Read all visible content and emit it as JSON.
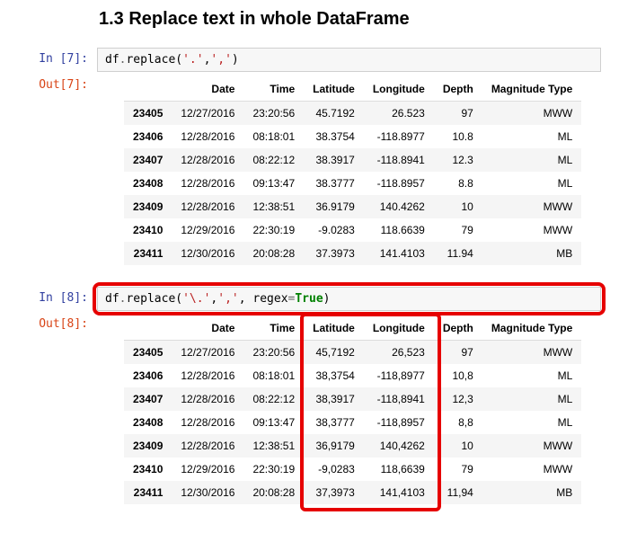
{
  "heading": "1.3  Replace text in whole DataFrame",
  "cell1": {
    "in_prompt": "In [7]:",
    "out_prompt": "Out[7]:",
    "code_plain": "df.replace('.',',')",
    "code_html": "df<span class='o'>.</span>replace(<span class='s'>'.'</span>,<span class='s'>','</span>)",
    "columns": [
      "Date",
      "Time",
      "Latitude",
      "Longitude",
      "Depth",
      "Magnitude Type"
    ],
    "index": [
      "23405",
      "23406",
      "23407",
      "23408",
      "23409",
      "23410",
      "23411"
    ],
    "rows": [
      [
        "12/27/2016",
        "23:20:56",
        "45.7192",
        "26.523",
        "97",
        "MWW"
      ],
      [
        "12/28/2016",
        "08:18:01",
        "38.3754",
        "-118.8977",
        "10.8",
        "ML"
      ],
      [
        "12/28/2016",
        "08:22:12",
        "38.3917",
        "-118.8941",
        "12.3",
        "ML"
      ],
      [
        "12/28/2016",
        "09:13:47",
        "38.3777",
        "-118.8957",
        "8.8",
        "ML"
      ],
      [
        "12/28/2016",
        "12:38:51",
        "36.9179",
        "140.4262",
        "10",
        "MWW"
      ],
      [
        "12/29/2016",
        "22:30:19",
        "-9.0283",
        "118.6639",
        "79",
        "MWW"
      ],
      [
        "12/30/2016",
        "20:08:28",
        "37.3973",
        "141.4103",
        "11.94",
        "MB"
      ]
    ]
  },
  "cell2": {
    "in_prompt": "In [8]:",
    "out_prompt": "Out[8]:",
    "code_plain": "df.replace('\\.',',', regex=True)",
    "code_html": "df<span class='o'>.</span>replace(<span class='s'>'\\.'</span>,<span class='s'>','</span>, regex<span class='o'>=</span><span class='kc'>True</span>)",
    "columns": [
      "Date",
      "Time",
      "Latitude",
      "Longitude",
      "Depth",
      "Magnitude Type"
    ],
    "index": [
      "23405",
      "23406",
      "23407",
      "23408",
      "23409",
      "23410",
      "23411"
    ],
    "rows": [
      [
        "12/27/2016",
        "23:20:56",
        "45,7192",
        "26,523",
        "97",
        "MWW"
      ],
      [
        "12/28/2016",
        "08:18:01",
        "38,3754",
        "-118,8977",
        "10,8",
        "ML"
      ],
      [
        "12/28/2016",
        "08:22:12",
        "38,3917",
        "-118,8941",
        "12,3",
        "ML"
      ],
      [
        "12/28/2016",
        "09:13:47",
        "38,3777",
        "-118,8957",
        "8,8",
        "ML"
      ],
      [
        "12/28/2016",
        "12:38:51",
        "36,9179",
        "140,4262",
        "10",
        "MWW"
      ],
      [
        "12/29/2016",
        "22:30:19",
        "-9,0283",
        "118,6639",
        "79",
        "MWW"
      ],
      [
        "12/30/2016",
        "20:08:28",
        "37,3973",
        "141,4103",
        "11,94",
        "MB"
      ]
    ],
    "highlight_cols": [
      2,
      3
    ]
  }
}
